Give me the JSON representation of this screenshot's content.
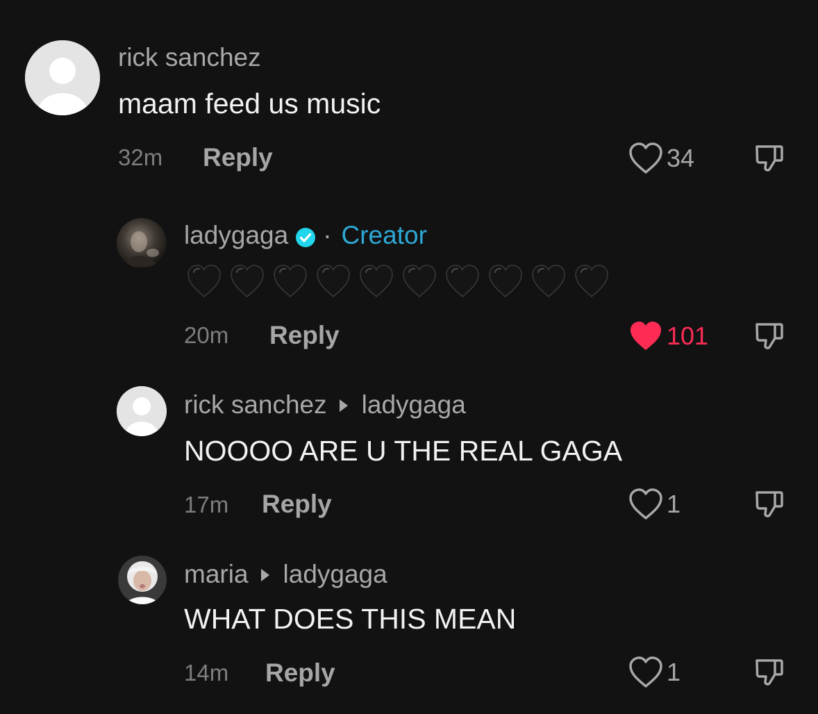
{
  "comments": [
    {
      "username": "rick sanchez",
      "text": "maam feed us music",
      "time": "32m",
      "reply_label": "Reply",
      "likes": "34",
      "liked": false
    },
    {
      "username": "ladygaga",
      "verified": true,
      "separator": "·",
      "badge": "Creator",
      "text_emoji": "black-heart x10",
      "time": "20m",
      "reply_label": "Reply",
      "likes": "101",
      "liked": true
    },
    {
      "username": "rick sanchez",
      "reply_to": "ladygaga",
      "text": "NOOOO ARE U THE REAL GAGA",
      "time": "17m",
      "reply_label": "Reply",
      "likes": "1",
      "liked": false
    },
    {
      "username": "maria",
      "reply_to": "ladygaga",
      "text": "WHAT DOES THIS MEAN",
      "time": "14m",
      "reply_label": "Reply",
      "likes": "1",
      "liked": false
    }
  ],
  "colors": {
    "background": "#121212",
    "creator_accent": "#2ea8d6",
    "liked_heart": "#fe2c55",
    "verified_badge": "#20d5ec"
  },
  "icons": [
    "heart-outline-icon",
    "heart-filled-icon",
    "dislike-icon",
    "verified-icon",
    "reply-arrow-icon",
    "black-heart-emoji"
  ]
}
